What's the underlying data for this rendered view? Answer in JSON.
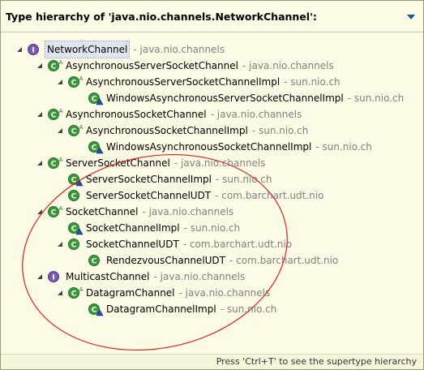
{
  "header": {
    "title": "Type hierarchy of 'java.nio.channels.NetworkChannel':"
  },
  "tree": [
    {
      "label": "NetworkChannel",
      "package": "- java.nio.channels",
      "depth": 0,
      "kind": "interface",
      "expanded": true,
      "selected": true
    },
    {
      "label": "AsynchronousServerSocketChannel",
      "package": "- java.nio.channels",
      "depth": 1,
      "kind": "abstract-class",
      "expanded": true
    },
    {
      "label": "AsynchronousServerSocketChannelImpl",
      "package": "- sun.nio.ch",
      "depth": 2,
      "kind": "abstract-class",
      "expanded": true
    },
    {
      "label": "WindowsAsynchronousServerSocketChannelImpl",
      "package": "- sun.nio.ch",
      "depth": 3,
      "kind": "class-default"
    },
    {
      "label": "AsynchronousSocketChannel",
      "package": "- java.nio.channels",
      "depth": 1,
      "kind": "abstract-class",
      "expanded": true
    },
    {
      "label": "AsynchronousSocketChannelImpl",
      "package": "- sun.nio.ch",
      "depth": 2,
      "kind": "abstract-class",
      "expanded": true
    },
    {
      "label": "WindowsAsynchronousSocketChannelImpl",
      "package": "- sun.nio.ch",
      "depth": 3,
      "kind": "class-default"
    },
    {
      "label": "ServerSocketChannel",
      "package": "- java.nio.channels",
      "depth": 1,
      "kind": "abstract-class",
      "expanded": true
    },
    {
      "label": "ServerSocketChannelImpl",
      "package": "- sun.nio.ch",
      "depth": 2,
      "kind": "class-default"
    },
    {
      "label": "ServerSocketChannelUDT",
      "package": "- com.barchart.udt.nio",
      "depth": 2,
      "kind": "class"
    },
    {
      "label": "SocketChannel",
      "package": "- java.nio.channels",
      "depth": 1,
      "kind": "abstract-class",
      "expanded": true
    },
    {
      "label": "SocketChannelImpl",
      "package": "- sun.nio.ch",
      "depth": 2,
      "kind": "class-default"
    },
    {
      "label": "SocketChannelUDT",
      "package": "- com.barchart.udt.nio",
      "depth": 2,
      "kind": "class",
      "expanded": true
    },
    {
      "label": "RendezvousChannelUDT",
      "package": "- com.barchart.udt.nio",
      "depth": 3,
      "kind": "class"
    },
    {
      "label": "MulticastChannel",
      "package": "- java.nio.channels",
      "depth": 1,
      "kind": "interface",
      "expanded": true
    },
    {
      "label": "DatagramChannel",
      "package": "- java.nio.channels",
      "depth": 2,
      "kind": "abstract-class",
      "expanded": true
    },
    {
      "label": "DatagramChannelImpl",
      "package": "- sun.nio.ch",
      "depth": 3,
      "kind": "class-default"
    }
  ],
  "footer": {
    "hint": "Press 'Ctrl+T' to see the supertype hierarchy"
  },
  "colors": {
    "background": "#fbfbe6",
    "package_text": "#808080",
    "class_icon": "#3a9a3a",
    "interface_icon": "#7b5ab0",
    "annotation_ellipse": "#d82020"
  },
  "icons": {
    "interface": "interface-icon",
    "abstract-class": "abstract-class-icon",
    "class": "class-icon",
    "class-default": "default-class-icon",
    "expanded": "expanded-triangle-icon",
    "menu": "view-menu-dropdown-icon"
  }
}
